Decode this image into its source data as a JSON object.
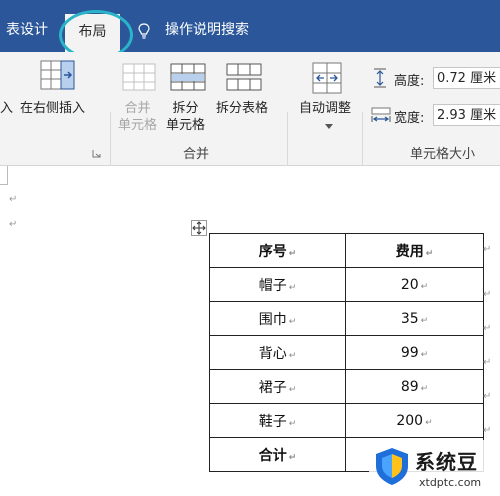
{
  "tabs": {
    "prev": "表设计",
    "active": "布局",
    "search": "操作说明搜索"
  },
  "ribbon": {
    "insert_left_partial": "入",
    "insert_right": "在右侧插入",
    "merge_cells": [
      "合并",
      "单元格"
    ],
    "split_cells": [
      "拆分",
      "单元格"
    ],
    "split_table": "拆分表格",
    "autofit": "自动调整",
    "group_merge": "合并",
    "group_cell_size": "单元格大小",
    "height_label": "高度:",
    "height_value": "0.72 厘米",
    "width_label": "宽度:",
    "width_value": "2.93 厘米"
  },
  "doc": {
    "paragraph_mark": "↵",
    "table": {
      "headers": [
        "序号",
        "费用"
      ],
      "rows": [
        [
          "帽子",
          "20"
        ],
        [
          "围巾",
          "35"
        ],
        [
          "背心",
          "99"
        ],
        [
          "裙子",
          "89"
        ],
        [
          "鞋子",
          "200"
        ]
      ],
      "total_label": "合计"
    }
  },
  "watermark": {
    "title": "系统豆",
    "url": "xtdptc.com"
  }
}
